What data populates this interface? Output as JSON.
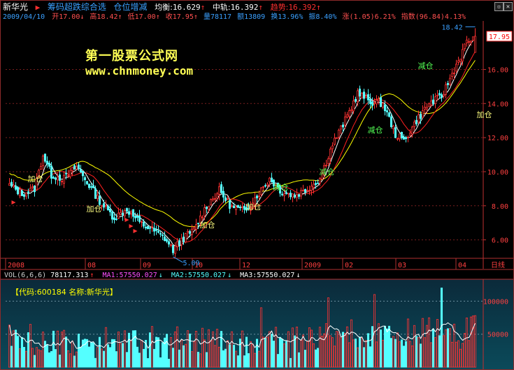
{
  "header": {
    "stock_name": "新华光",
    "indicator_name": "筹码超跌综合选",
    "indicator_sub": "仓位增减",
    "avg_label": "均衡:",
    "avg_value": "16.629",
    "mid_label": "中轨:",
    "mid_value": "16.392",
    "trend_label": "趋势:",
    "trend_value": "16.392",
    "date": "2009/04/10",
    "open_label": "开",
    "open_value": "17.00",
    "high_label": "高",
    "high_value": "18.42",
    "low_label": "低",
    "low_value": "17.00",
    "close_label": "收",
    "close_value": "17.95",
    "volume_label": "量",
    "volume_value": "78117",
    "amount_label": "额",
    "amount_value": "13809",
    "turnover_label": "换",
    "turnover_value": "13.96%",
    "amplitude_label": "振",
    "amplitude_value": "8.40%",
    "change_label": "涨",
    "change_value": "(1.05)6.21%",
    "index_label": "指数",
    "index_value": "(96.84)4.13%"
  },
  "watermark": {
    "title": "第一股票公式网",
    "url": "www.chnmoney.com"
  },
  "volume_header": {
    "label": "VOL(6,6,6)",
    "vol_value": "78117.313",
    "ma1": "MA1:57550.027",
    "ma2": "MA2:57550.027",
    "ma3": "MA3:57550.027"
  },
  "code_line": "【代码:600184 名称:新华光】",
  "price_annotations": {
    "high_marker": "18.42",
    "low_marker": "5.09",
    "right_close": "17.95"
  },
  "timeline": {
    "labels": [
      "2008",
      "08",
      "09",
      "10",
      "12",
      "2009",
      "02",
      "03",
      "04"
    ],
    "right_label": "日线"
  },
  "signals": [
    "加仓",
    "加仓",
    "减仓",
    "加仓",
    "加仓",
    "减仓",
    "减仓",
    "减仓",
    "加仓"
  ],
  "colors": {
    "up": "#ff3232",
    "down": "#54ffff",
    "ma_white": "#ffffff",
    "ma_red": "#ff2020",
    "ma_yellow": "#ffff00",
    "grid": "#7a1f1f",
    "axis_text": "#ff4040",
    "vol_bg_top": "#0b2a3a",
    "vol_bg_bottom": "#0b4a5a"
  },
  "chart_data": {
    "type": "candlestick",
    "price_axis": {
      "ticks": [
        6.0,
        8.0,
        10.0,
        12.0,
        14.0,
        16.0
      ],
      "ylim": [
        5.0,
        18.6
      ]
    },
    "volume_axis": {
      "ticks": [
        50000,
        100000
      ],
      "ylim": [
        0,
        130000
      ]
    },
    "x_period_labels": [
      "2008",
      "08",
      "09",
      "10",
      "12",
      "2009",
      "02",
      "03",
      "04"
    ],
    "anchor_points": [
      {
        "i": 0,
        "c": 9.2
      },
      {
        "i": 6,
        "c": 8.7
      },
      {
        "i": 12,
        "c": 9.0
      },
      {
        "i": 16,
        "c": 11.0
      },
      {
        "i": 20,
        "c": 9.8
      },
      {
        "i": 26,
        "c": 9.6
      },
      {
        "i": 32,
        "c": 10.3
      },
      {
        "i": 38,
        "c": 9.2
      },
      {
        "i": 44,
        "c": 8.1
      },
      {
        "i": 50,
        "c": 7.3
      },
      {
        "i": 56,
        "c": 7.8
      },
      {
        "i": 62,
        "c": 7.0
      },
      {
        "i": 68,
        "c": 6.6
      },
      {
        "i": 74,
        "c": 6.1
      },
      {
        "i": 78,
        "c": 5.4
      },
      {
        "i": 82,
        "c": 6.0
      },
      {
        "i": 88,
        "c": 6.6
      },
      {
        "i": 94,
        "c": 8.0
      },
      {
        "i": 100,
        "c": 8.9
      },
      {
        "i": 106,
        "c": 7.9
      },
      {
        "i": 112,
        "c": 7.7
      },
      {
        "i": 118,
        "c": 8.6
      },
      {
        "i": 124,
        "c": 9.6
      },
      {
        "i": 130,
        "c": 8.8
      },
      {
        "i": 136,
        "c": 8.6
      },
      {
        "i": 142,
        "c": 9.0
      },
      {
        "i": 148,
        "c": 9.6
      },
      {
        "i": 154,
        "c": 11.6
      },
      {
        "i": 160,
        "c": 13.0
      },
      {
        "i": 166,
        "c": 14.6
      },
      {
        "i": 172,
        "c": 14.1
      },
      {
        "i": 178,
        "c": 14.0
      },
      {
        "i": 184,
        "c": 12.2
      },
      {
        "i": 188,
        "c": 11.8
      },
      {
        "i": 194,
        "c": 13.0
      },
      {
        "i": 200,
        "c": 14.0
      },
      {
        "i": 206,
        "c": 14.4
      },
      {
        "i": 212,
        "c": 16.0
      },
      {
        "i": 218,
        "c": 17.6
      },
      {
        "i": 222,
        "c": 17.95
      }
    ],
    "notable": {
      "high": 18.42,
      "low": 5.09,
      "last_close": 17.95,
      "last_volume": 78117.313
    }
  }
}
